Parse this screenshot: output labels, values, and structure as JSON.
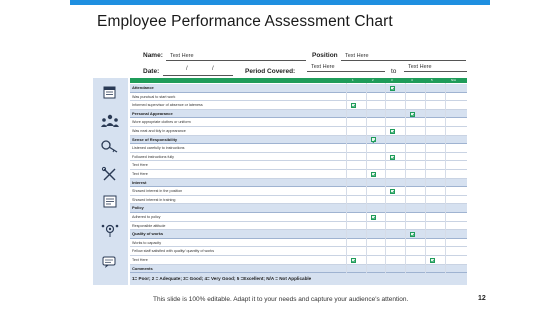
{
  "title": "Employee Performance Assessment Chart",
  "form": {
    "name_label": "Name:",
    "name_value": "Text Here",
    "position_label": "Position",
    "position_value": "Text Here",
    "date_label": "Date:",
    "date_sep1": "/",
    "date_sep2": "/",
    "period_label": "Period Covered:",
    "period_from": "Text Here",
    "period_to_label": "to",
    "period_to": "Text Here"
  },
  "header_cols": [
    "1",
    "2",
    "3",
    "4",
    "5",
    "N/A"
  ],
  "rows": [
    {
      "text": "Attendance",
      "section": true,
      "check": 3
    },
    {
      "text": "Was punctual to start work",
      "section": false,
      "check": null
    },
    {
      "text": "Informed supervisor of absence or lateness",
      "section": false,
      "check": 1
    },
    {
      "text": "Personal Appearance",
      "section": true,
      "check": 4
    },
    {
      "text": "Wore appropriate clothes or uniform",
      "section": false,
      "check": null
    },
    {
      "text": "Was neat and tidy in appearance",
      "section": false,
      "check": 3
    },
    {
      "text": "Sense of Responsibility",
      "section": true,
      "check": 2
    },
    {
      "text": "Listened carefully to instructions",
      "section": false,
      "check": null
    },
    {
      "text": "Followed instructions fully",
      "section": false,
      "check": 3
    },
    {
      "text": "Text Here",
      "section": false,
      "check": null
    },
    {
      "text": "Text Here",
      "section": false,
      "check": 2
    },
    {
      "text": "Interest",
      "section": true,
      "check": null
    },
    {
      "text": "Showed interest in the position",
      "section": false,
      "check": 3
    },
    {
      "text": "Showed interest in training",
      "section": false,
      "check": null
    },
    {
      "text": "Policy",
      "section": true,
      "check": null
    },
    {
      "text": "Adhered to policy",
      "section": false,
      "check": 2
    },
    {
      "text": "Responsible attitude",
      "section": false,
      "check": null
    },
    {
      "text": "Quality of works",
      "section": true,
      "check": 4
    },
    {
      "text": "Works to capacity",
      "section": false,
      "check": null
    },
    {
      "text": "Fellow staff satisfied with quality/ quantity of works",
      "section": false,
      "check": null
    },
    {
      "text": "Text Here",
      "section": false,
      "check": "1,5"
    },
    {
      "text": "Comments",
      "section": true,
      "check": null
    }
  ],
  "icons": [
    "calendar-icon",
    "people-icon",
    "key-icon",
    "tools-icon",
    "policy-icon",
    "quality-icon",
    "comments-icon"
  ],
  "legend": "1= Poor; 2 = Adequate; 3= Good; 4= Very Good; 5 =Excellent; N/A = Not Applicable",
  "footer": "This slide is 100% editable. Adapt it to your needs and capture your audience's attention.",
  "page_number": "12",
  "colors": {
    "accent_blue": "#1f8fe0",
    "header_green": "#1f9c5a",
    "section_blue": "#d6e1f0"
  }
}
